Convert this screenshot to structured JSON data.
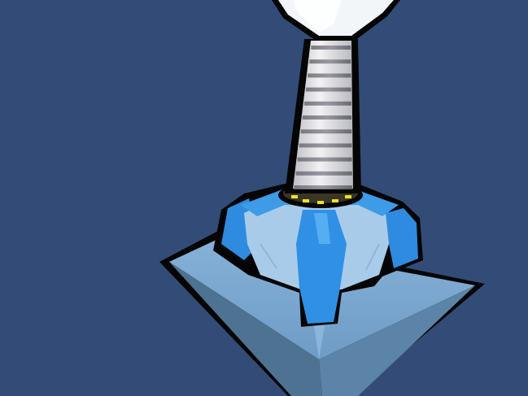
{
  "scene": {
    "background_color": "#324c77",
    "outline_color": "#050505",
    "objects": [
      "tower-base-platform",
      "tower-bulb-base",
      "tower-column",
      "tower-lamp-head"
    ],
    "colors": {
      "platform_top": "#7aa6d0",
      "platform_side_left": "#4d7190",
      "platform_side_right": "#5d86aa",
      "bulb_light": "#9ec4e6",
      "bulb_blue": "#2e8fe6",
      "column_white": "#e7e7ea",
      "column_ring": "#5a5a62",
      "collar_dark": "#3a3526",
      "collar_lights": "#f2e02a",
      "lamp_white": "#f2f6f8"
    }
  }
}
